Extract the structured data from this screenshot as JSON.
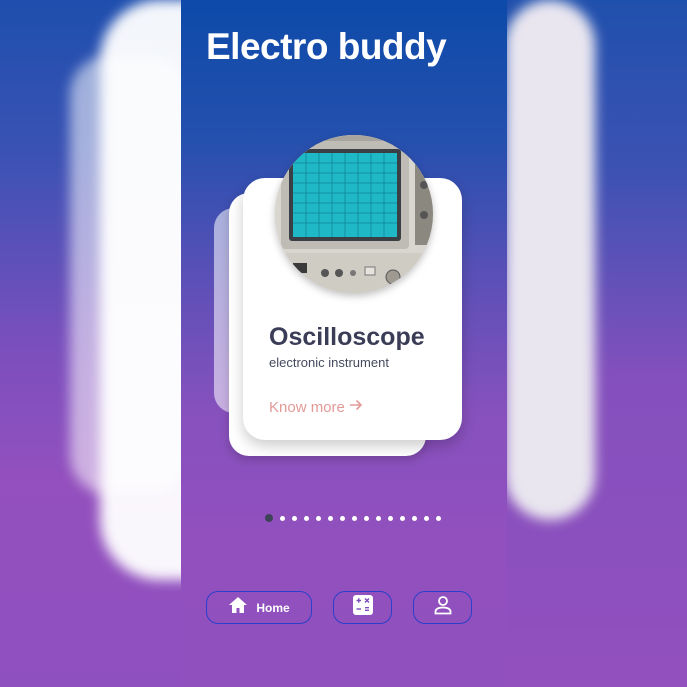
{
  "app": {
    "title": "Electro buddy"
  },
  "card": {
    "title": "Oscilloscope",
    "subtitle": "electronic instrument",
    "link_label": "Know more",
    "link_icon": "arrow-right-icon",
    "image_icon": "oscilloscope-photo"
  },
  "pager": {
    "total": 15,
    "active": 0
  },
  "nav": {
    "home_label": "Home",
    "home_icon": "home-icon",
    "calculator_icon": "calculator-icon",
    "profile_icon": "profile-icon"
  },
  "colors": {
    "gradient_top": "#0d4aa9",
    "gradient_bottom": "#9050be",
    "card_title": "#3b3d57",
    "link": "#e29a98",
    "nav_border": "#2b3fc9"
  }
}
